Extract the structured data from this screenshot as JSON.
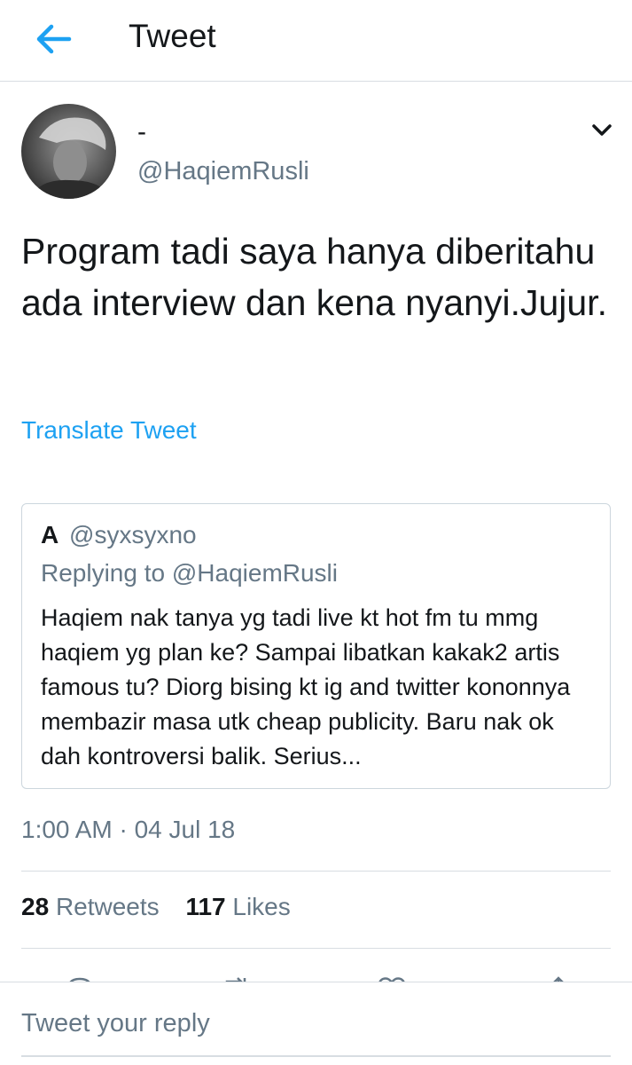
{
  "header": {
    "title": "Tweet",
    "back_icon": "arrow-left-icon",
    "accent_color": "#1da1f2"
  },
  "tweet": {
    "author": {
      "display_name": "-",
      "handle": "@HaqiemRusli"
    },
    "text": "Program tadi saya hanya diberitahu ada interview dan kena nyanyi.Jujur.",
    "translate_label": "Translate Tweet",
    "timestamp": "1:00 AM · 04 Jul 18"
  },
  "quoted_tweet": {
    "name": "A",
    "handle": "@syxsyxno",
    "replying_to": "Replying to @HaqiemRusli",
    "text": "Haqiem nak tanya yg tadi live kt hot fm tu mmg haqiem yg plan ke? Sampai libatkan kakak2 artis famous tu? Diorg bising kt ig and twitter kononnya membazir masa utk cheap publicity. Baru nak ok dah kontroversi balik. Serius..."
  },
  "stats": {
    "retweets_count": "28",
    "retweets_label": "Retweets",
    "likes_count": "117",
    "likes_label": "Likes"
  },
  "actions": [
    "reply-icon",
    "retweet-icon",
    "like-icon",
    "share-icon"
  ],
  "reply": {
    "placeholder": "Tweet your reply"
  }
}
